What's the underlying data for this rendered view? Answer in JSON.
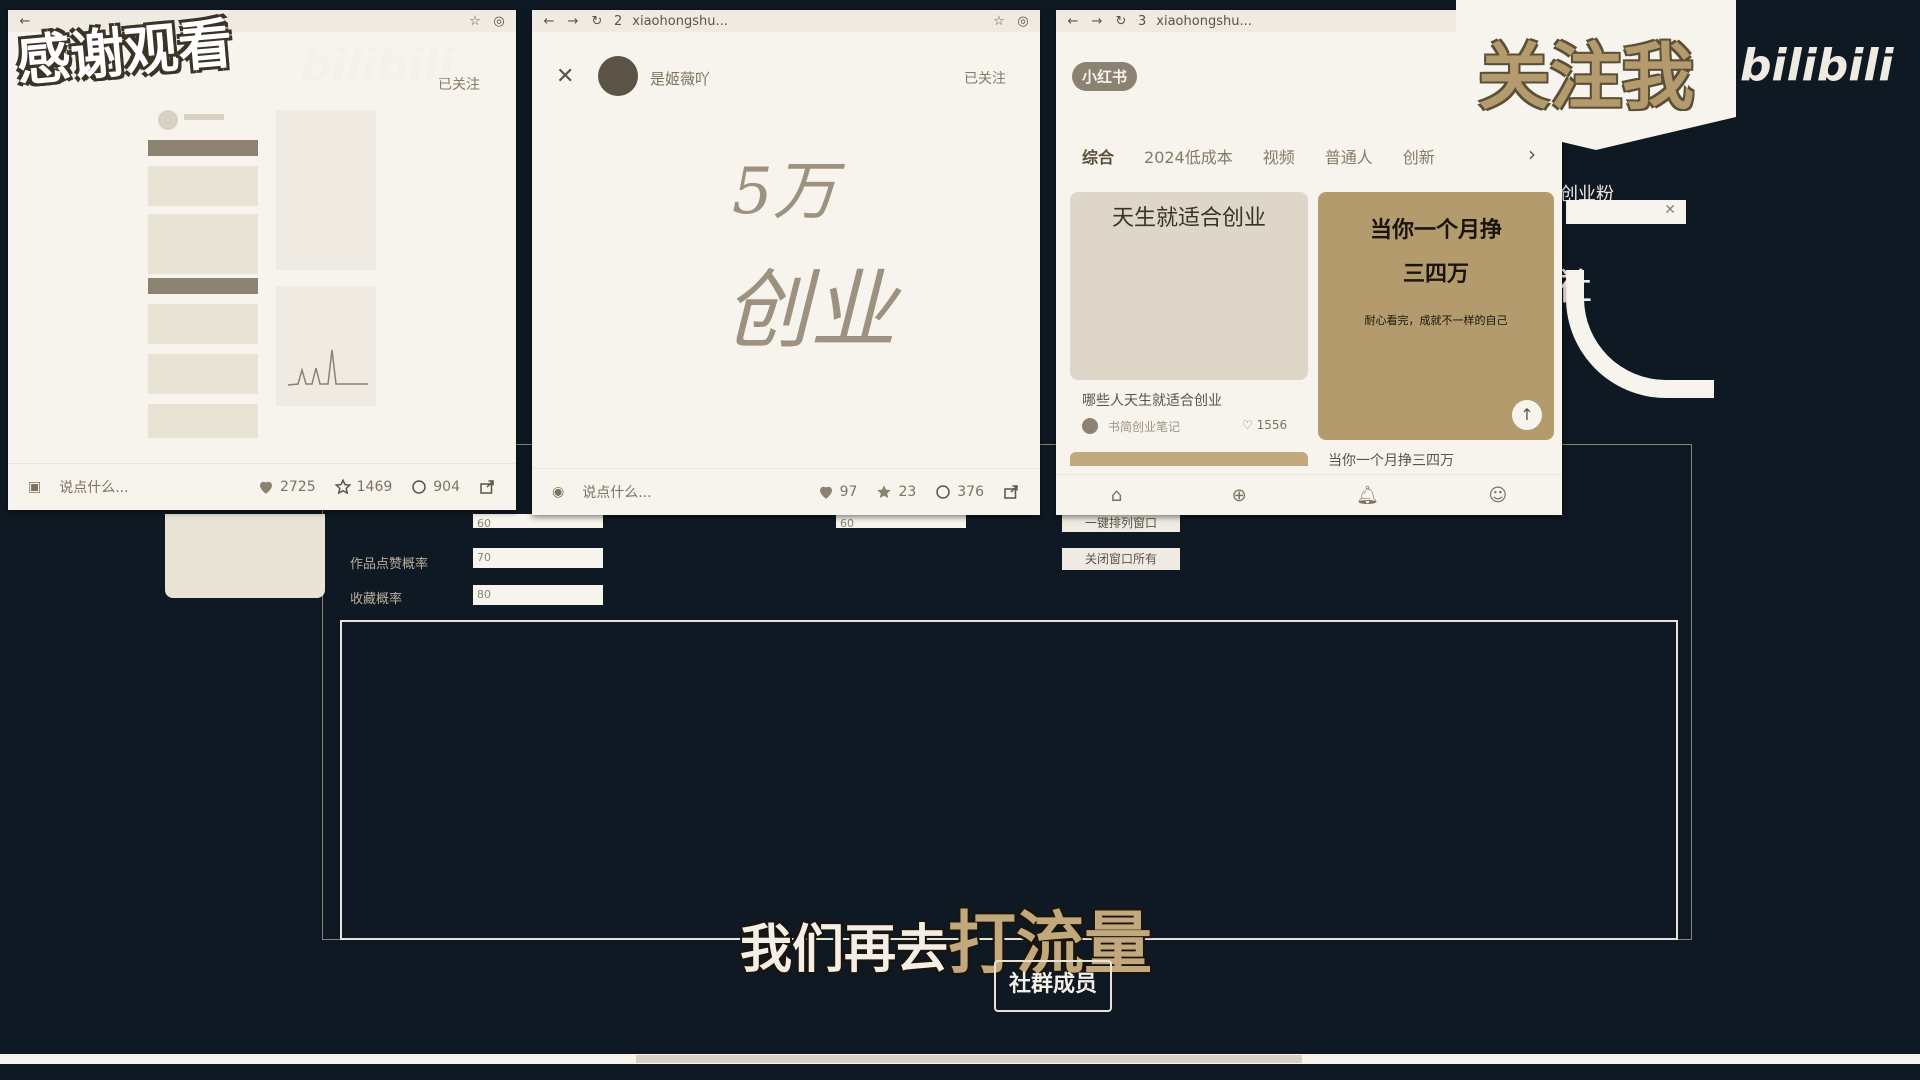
{
  "overlay": {
    "thanks_text": "感谢观看",
    "follow_me_text": "关注我",
    "bilibili_text": "bilibili"
  },
  "window1": {
    "follow_label": "已关注",
    "comment_placeholder": "说点什么...",
    "likes": "2725",
    "stars": "1469",
    "comments": "904"
  },
  "window2": {
    "tab_number": "2",
    "url": "xiaohongshu...",
    "author": "是姬薇吖",
    "follow_label": "已关注",
    "handwriting_line1": "5万",
    "handwriting_line2": "创业",
    "comment_placeholder": "说点什么...",
    "likes": "97",
    "stars": "23",
    "comments": "376"
  },
  "window3": {
    "tab_number": "3",
    "url": "xiaohongshu...",
    "logo": "小红书",
    "tabs": [
      "综合",
      "2024低成本",
      "视频",
      "普通人",
      "创新"
    ],
    "card1": {
      "headline": "天生就适合创业",
      "caption": "哪些人天生就适合创业",
      "author": "书简创业笔记",
      "likes": "1556"
    },
    "card2": {
      "headline_line1": "当你一个月挣",
      "headline_line2": "三四万",
      "subline": "耐心看完，成就不一样的自己",
      "caption": "当你一个月挣三四万"
    }
  },
  "background_app": {
    "label_row2": "作品点赞概率",
    "label_row3": "收藏概率",
    "value_row1": "60",
    "value_row2": "70",
    "value_row3": "80",
    "value_mid": "60",
    "btn1": "一键排列窗口",
    "btn2": "关闭窗口所有",
    "side_text": "创业粉",
    "side_text2": "社"
  },
  "subtitle": {
    "main": "我们再去",
    "highlight": "打流量",
    "badge": "社群成员"
  },
  "colors": {
    "background": "#0f1923",
    "window": "#f7f4ee",
    "accent": "#b39b6d"
  }
}
